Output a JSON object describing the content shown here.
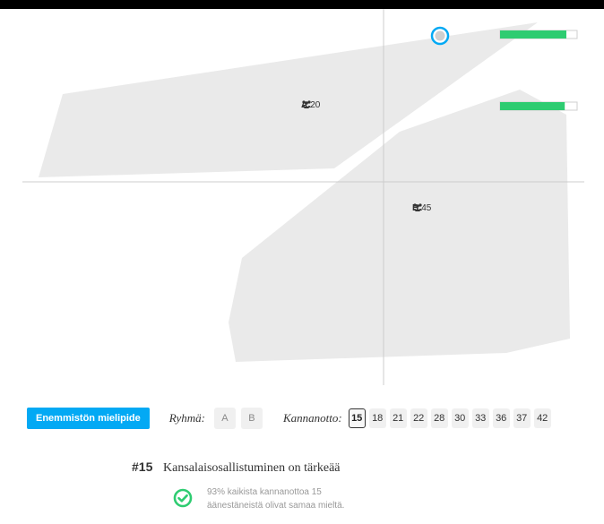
{
  "groups": [
    {
      "letter": "A",
      "count": "20"
    },
    {
      "letter": "B",
      "count": "45"
    }
  ],
  "groups_icon": "people-icon",
  "consensus_bars": [
    {
      "fill": 0.86,
      "color": "#2ecc71"
    },
    {
      "fill": 0.84,
      "color": "#2ecc71"
    }
  ],
  "toolbar": {
    "majority_button": "Enemmistön mielipide",
    "group_label": "Ryhmä:",
    "group_options": [
      "A",
      "B"
    ],
    "statement_label": "Kannanotto:",
    "statements": [
      "15",
      "18",
      "21",
      "22",
      "28",
      "30",
      "33",
      "36",
      "37",
      "42"
    ],
    "selected_statement": "15"
  },
  "statement": {
    "number": "#15",
    "text": "Kansalaisosallistuminen on tärkeää",
    "summary_line1": "93% kaikista kannanottoa 15",
    "summary_line2": "äänestäneistä olivat samaa mieltä."
  },
  "colors": {
    "accent": "#03a9f4",
    "agree": "#2ecc71",
    "hull": "#eaeaea"
  }
}
